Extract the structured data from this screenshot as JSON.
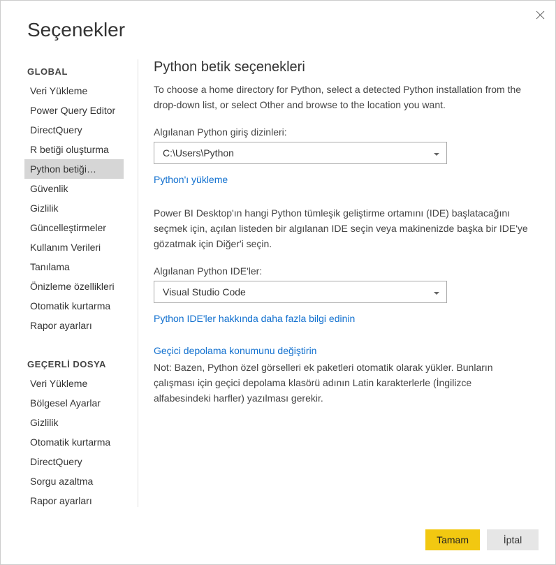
{
  "dialog": {
    "title": "Seçenekler"
  },
  "sidebar": {
    "global_header": "GLOBAL",
    "current_file_header": "GEÇERLİ DOSYA",
    "global_items": [
      "Veri Yükleme",
      "Power Query Editor",
      "DirectQuery",
      "R betiği oluşturma",
      "Python betiği…",
      "Güvenlik",
      "Gizlilik",
      "Güncelleştirmeler",
      "Kullanım Verileri",
      "Tanılama",
      "Önizleme özellikleri",
      "Otomatik kurtarma",
      "Rapor ayarları"
    ],
    "current_file_items": [
      "Veri Yükleme",
      "Bölgesel Ayarlar",
      "Gizlilik",
      "Otomatik kurtarma",
      "DirectQuery",
      "Sorgu azaltma",
      "Rapor ayarları"
    ],
    "selected_index": 4
  },
  "main": {
    "title": "Python betik seçenekleri",
    "description": "To choose a home directory for Python, select a detected Python installation from the drop-down list, or select Other and browse to the location you want.",
    "home_dir_label": "Algılanan Python giriş dizinleri:",
    "home_dir_value": "C:\\Users\\Python",
    "install_link": "Python'ı yükleme",
    "ide_description": "Power BI Desktop'ın hangi Python tümleşik geliştirme ortamını (IDE) başlatacağını seçmek için, açılan listeden bir algılanan IDE seçin veya makinenizde başka bir IDE'ye gözatmak için Diğer'i seçin.",
    "ide_label": "Algılanan Python IDE'ler:",
    "ide_value": "Visual Studio Code",
    "ide_link": "Python IDE'ler hakkında daha fazla bilgi edinin",
    "temp_link": "Geçici depolama konumunu değiştirin",
    "note": "Not: Bazen, Python özel görselleri ek paketleri otomatik olarak yükler. Bunların çalışması için geçici depolama klasörü adının Latin karakterlerle (İngilizce alfabesindeki harfler) yazılması gerekir."
  },
  "footer": {
    "ok": "Tamam",
    "cancel": "İptal"
  }
}
